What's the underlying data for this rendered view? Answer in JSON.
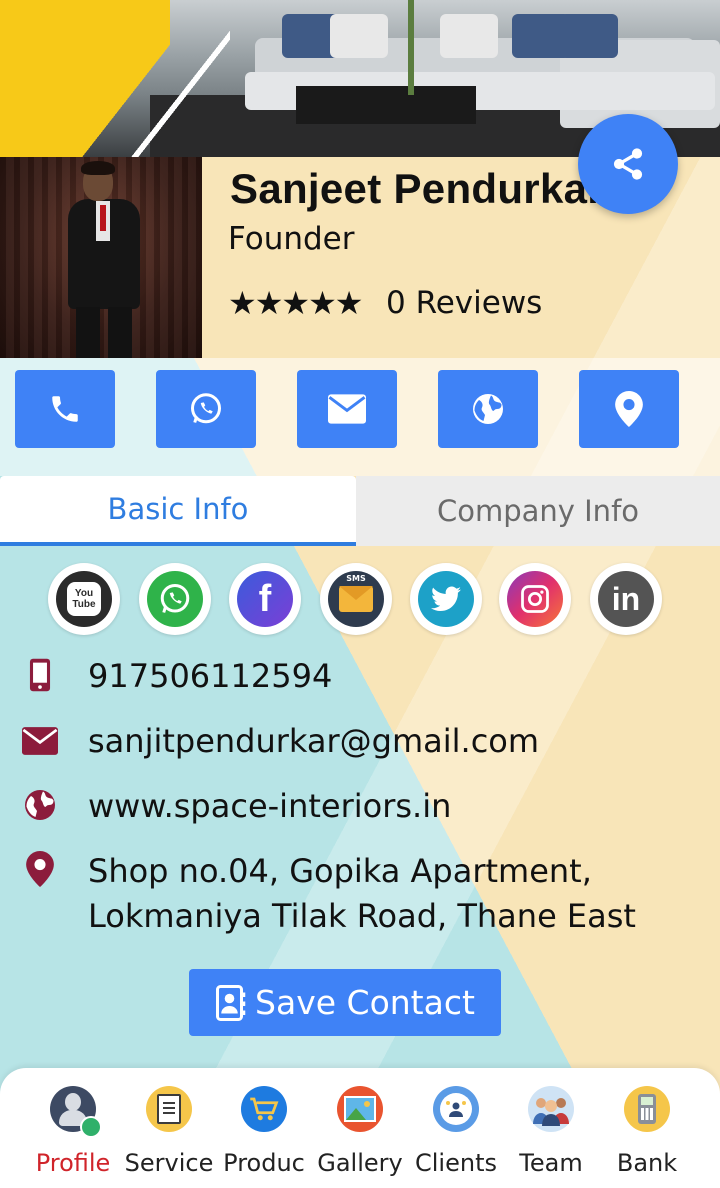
{
  "profile": {
    "name": "Sanjeet Pendurkar",
    "role": "Founder",
    "stars": "★★★★★",
    "reviews": "0 Reviews"
  },
  "actions": [
    {
      "icon": "phone-icon"
    },
    {
      "icon": "whatsapp-icon"
    },
    {
      "icon": "mail-icon"
    },
    {
      "icon": "globe-icon"
    },
    {
      "icon": "location-pin-icon"
    }
  ],
  "tabs": {
    "basic": "Basic Info",
    "company": "Company Info",
    "active": "basic"
  },
  "social": [
    {
      "name": "youtube",
      "text": "You Tube"
    },
    {
      "name": "whatsapp"
    },
    {
      "name": "facebook",
      "text": "f"
    },
    {
      "name": "sms",
      "text": "SMS"
    },
    {
      "name": "twitter"
    },
    {
      "name": "instagram"
    },
    {
      "name": "linkedin",
      "text": "in"
    }
  ],
  "contact": {
    "phone": "917506112594",
    "email": "sanjitpendurkar@gmail.com",
    "website": "www.space-interiors.in",
    "address_line1": "Shop no.04, Gopika Apartment,",
    "address_line2": "Lokmaniya Tilak Road, Thane East"
  },
  "save_contact": "Save Contact",
  "nav": [
    {
      "label": "Profile",
      "active": true
    },
    {
      "label": "Service"
    },
    {
      "label": "Produc"
    },
    {
      "label": "Gallery"
    },
    {
      "label": "Clients"
    },
    {
      "label": "Team"
    },
    {
      "label": "Bank"
    }
  ],
  "colors": {
    "accent": "#3f82f6",
    "tab_active": "#2f7de0",
    "icon_maroon": "#8c1c3c",
    "nav_active": "#d0242a",
    "banner_yellow": "#f7c918"
  }
}
